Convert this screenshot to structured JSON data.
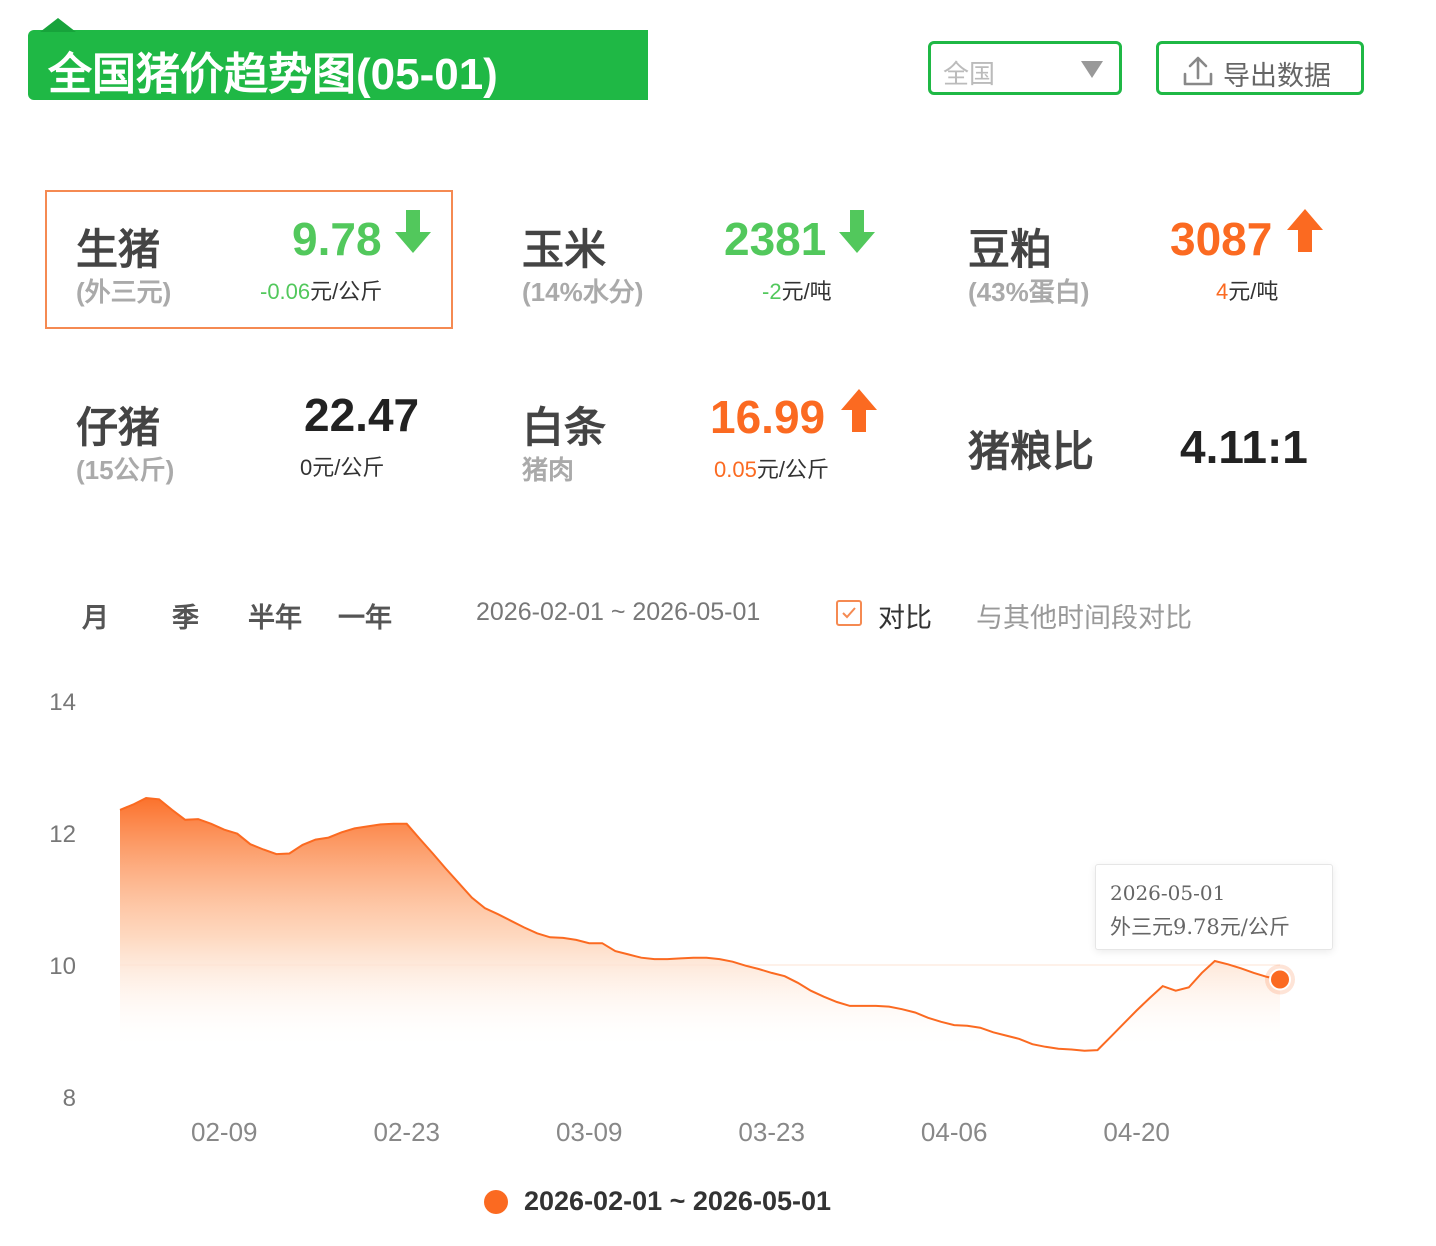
{
  "header": {
    "title": "全国猪价趋势图(05-01)"
  },
  "controls": {
    "region_value": "全国",
    "export_label": "导出数据"
  },
  "cards": [
    {
      "name": "生猪",
      "sub": "(外三元)",
      "value": "9.78",
      "direction": "down",
      "delta": "-0.06",
      "unit": "元/公斤"
    },
    {
      "name": "玉米",
      "sub": "(14%水分)",
      "value": "2381",
      "direction": "down",
      "delta": "-2",
      "unit": "元/吨"
    },
    {
      "name": "豆粕",
      "sub": "(43%蛋白)",
      "value": "3087",
      "direction": "up",
      "delta": "4",
      "unit": "元/吨"
    },
    {
      "name": "仔猪",
      "sub": "(15公斤)",
      "value": "22.47",
      "direction": "flat",
      "delta": "0",
      "unit": "元/公斤"
    },
    {
      "name": "白条",
      "sub": "猪肉",
      "value": "16.99",
      "direction": "up",
      "delta": "0.05",
      "unit": "元/公斤"
    },
    {
      "name": "猪粮比",
      "value": "4.11:1"
    }
  ],
  "tabs": [
    "月",
    "季",
    "半年",
    "一年"
  ],
  "date_range": "2026-02-01 ~ 2026-05-01",
  "compare": {
    "checkbox_label": "对比",
    "other_label": "与其他时间段对比"
  },
  "colors": {
    "accent_green": "#1fb845",
    "series_orange": "#fb6a21",
    "down_green": "#52c85c"
  },
  "chart_data": {
    "type": "area",
    "x": [
      "02-01",
      "02-02",
      "02-03",
      "02-04",
      "02-05",
      "02-06",
      "02-07",
      "02-08",
      "02-09",
      "02-10",
      "02-11",
      "02-12",
      "02-13",
      "02-14",
      "02-15",
      "02-16",
      "02-17",
      "02-18",
      "02-19",
      "02-20",
      "02-21",
      "02-22",
      "02-23",
      "02-24",
      "02-25",
      "02-26",
      "02-27",
      "02-28",
      "03-01",
      "03-02",
      "03-03",
      "03-04",
      "03-05",
      "03-06",
      "03-07",
      "03-08",
      "03-09",
      "03-10",
      "03-11",
      "03-12",
      "03-13",
      "03-14",
      "03-15",
      "03-16",
      "03-17",
      "03-18",
      "03-19",
      "03-20",
      "03-21",
      "03-22",
      "03-23",
      "03-24",
      "03-25",
      "03-26",
      "03-27",
      "03-28",
      "03-29",
      "03-30",
      "03-31",
      "04-01",
      "04-02",
      "04-03",
      "04-04",
      "04-05",
      "04-06",
      "04-07",
      "04-08",
      "04-09",
      "04-10",
      "04-11",
      "04-12",
      "04-13",
      "04-14",
      "04-15",
      "04-16",
      "04-17",
      "04-18",
      "04-19",
      "04-20",
      "04-21",
      "04-22",
      "04-23",
      "04-24",
      "04-25",
      "04-26",
      "04-27",
      "04-28",
      "04-29",
      "04-30",
      "05-01"
    ],
    "series": [
      {
        "name": "2026-02-01 ~ 2026-05-01",
        "values": [
          12.35,
          12.43,
          12.53,
          12.51,
          12.35,
          12.2,
          12.21,
          12.14,
          12.05,
          11.99,
          11.83,
          11.75,
          11.68,
          11.69,
          11.82,
          11.9,
          11.93,
          12.01,
          12.07,
          12.1,
          12.13,
          12.14,
          12.14,
          11.91,
          11.69,
          11.46,
          11.24,
          11.02,
          10.86,
          10.77,
          10.67,
          10.57,
          10.48,
          10.42,
          10.41,
          10.38,
          10.33,
          10.33,
          10.21,
          10.16,
          10.11,
          10.09,
          10.09,
          10.1,
          10.11,
          10.11,
          10.09,
          10.05,
          9.99,
          9.94,
          9.88,
          9.83,
          9.73,
          9.61,
          9.52,
          9.44,
          9.38,
          9.38,
          9.38,
          9.37,
          9.33,
          9.28,
          9.2,
          9.14,
          9.09,
          9.08,
          9.05,
          8.98,
          8.93,
          8.88,
          8.8,
          8.76,
          8.73,
          8.72,
          8.7,
          8.71,
          8.91,
          9.11,
          9.31,
          9.5,
          9.68,
          9.61,
          9.66,
          9.88,
          10.06,
          10.01,
          9.95,
          9.88,
          9.82,
          9.78
        ]
      }
    ],
    "x_ticks": [
      "02-09",
      "02-23",
      "03-09",
      "03-23",
      "04-06",
      "04-20"
    ],
    "y_ticks": [
      8,
      10,
      12,
      14
    ],
    "ylim": [
      8,
      14
    ],
    "grid": false,
    "legend": "bottom-center",
    "tooltip": {
      "date": "2026-05-01",
      "text": "外三元9.78元/公斤"
    }
  }
}
